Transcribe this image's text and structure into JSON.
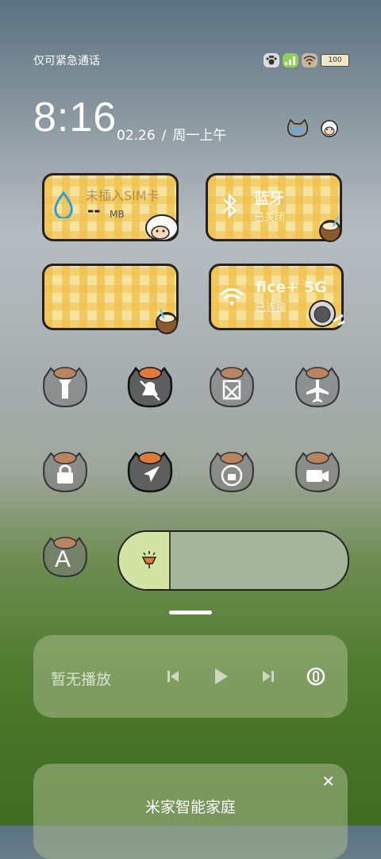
{
  "status": {
    "carrier": "仅可紧急通话",
    "battery": "100"
  },
  "clock": {
    "time": "8:16",
    "date": "02.26",
    "sep": "/",
    "weekday": "周一上午"
  },
  "tiles": {
    "sim": {
      "label": "未插入SIM卡",
      "value": "--",
      "unit": "MB"
    },
    "bluetooth": {
      "label": "蓝牙",
      "status": "已关闭"
    },
    "blank": {
      "label": "",
      "status": ""
    },
    "wifi": {
      "label": "fice+ 5G",
      "status": "已连接"
    }
  },
  "toggles": [
    {
      "name": "flashlight",
      "icon": "flashlight-icon"
    },
    {
      "name": "mute",
      "icon": "bell-off-icon"
    },
    {
      "name": "screenshot",
      "icon": "scissors-icon"
    },
    {
      "name": "airplane",
      "icon": "airplane-icon"
    },
    {
      "name": "lock",
      "icon": "lock-icon"
    },
    {
      "name": "location",
      "icon": "location-arrow-icon"
    },
    {
      "name": "rotation",
      "icon": "rotation-lock-icon"
    },
    {
      "name": "screen-record",
      "icon": "video-icon"
    },
    {
      "name": "auto-brightness",
      "icon": "font-a-icon",
      "letter": "A"
    }
  ],
  "brightness": {
    "level": 0.22
  },
  "media": {
    "text": "暂无播放"
  },
  "smarthome": {
    "title": "米家智能家庭",
    "close": "✕"
  },
  "colors": {
    "accent": "#f0be46",
    "tile_bg": "#f7e3a0",
    "outline": "#222222"
  }
}
